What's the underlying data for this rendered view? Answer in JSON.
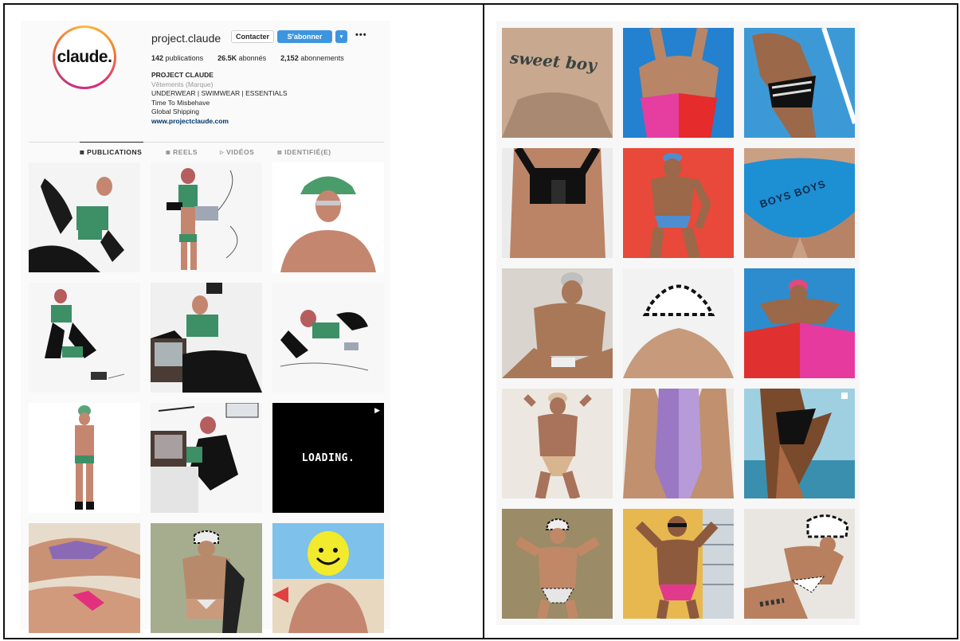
{
  "profile": {
    "avatar_text": "claude.",
    "username": "project.claude",
    "contact_label": "Contacter",
    "follow_label": "S'abonner",
    "dropdown_icon": "chevron-down-icon",
    "more_icon": "•••",
    "stats": {
      "publications_count": "142",
      "publications_label": "publications",
      "followers_count": "26.5K",
      "followers_label": "abonnés",
      "following_count": "2,152",
      "following_label": "abonnements"
    },
    "bio": {
      "name": "PROJECT CLAUDE",
      "category": "Vêtements (Marque)",
      "line1": "UNDERWEAR | SWIMWEAR | ESSENTIALS",
      "line2": "Time To Misbehave",
      "line3": "Global Shipping",
      "website": "www.projectclaude.com"
    }
  },
  "tabs": [
    {
      "label": "PUBLICATIONS",
      "icon": "▦",
      "active": true
    },
    {
      "label": "REELS",
      "icon": "▣",
      "active": false
    },
    {
      "label": "VIDÉOS",
      "icon": "▷",
      "active": false
    },
    {
      "label": "IDENTIFIÉ(E)",
      "icon": "▤",
      "active": false
    }
  ],
  "left_grid": {
    "loading_text": "LOADING."
  },
  "right_grid": {
    "tattoo_text": "sweet boy",
    "print_text": "BOYS BOYS"
  }
}
